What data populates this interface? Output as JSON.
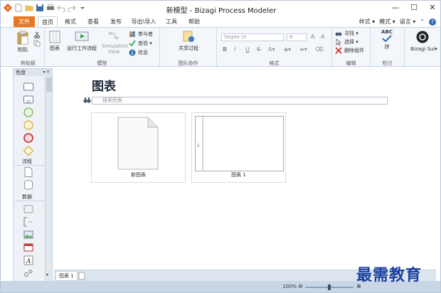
{
  "window": {
    "title": "新模型 - Bizagi Process Modeler"
  },
  "tabs": {
    "file": "文件",
    "home": "首页",
    "format": "格式",
    "view": "查看",
    "publish": "发布",
    "export_import": "导出\\导入",
    "tools": "工具",
    "help": "帮助"
  },
  "right_menus": {
    "styles": "样式 ▾",
    "modes": "模式 ▾",
    "language": "语言 ▾"
  },
  "ribbon": {
    "clipboard": {
      "paste": "粘贴",
      "label": "剪贴板"
    },
    "model": {
      "diagram": "图表",
      "run_workflow": "运行工作流程",
      "simulation": "Simulation View",
      "participants": "参与者",
      "check": "查验 ▾",
      "info": "信息",
      "label": "模型"
    },
    "collab": {
      "share": "共享过程",
      "label": "团队协作"
    },
    "font": {
      "family": "Segoe UI",
      "size": "8",
      "bold": "B",
      "italic": "I",
      "underline": "U",
      "strike": "S",
      "label": "格式"
    },
    "edit": {
      "find": "寻找 ▾",
      "select": "选择 ▾",
      "delete": "删除组件",
      "label": "编辑"
    },
    "spell": {
      "abc": "ABC",
      "spell": "拼",
      "label": "检讨"
    },
    "bizagi": {
      "label": "Bizagi Sui▾"
    }
  },
  "palette": {
    "title": "色盘",
    "pin": "▾ ⊓",
    "flow": "流程",
    "data": "数据"
  },
  "main": {
    "heading": "图表",
    "search_placeholder": "搜索图表",
    "cards": [
      {
        "label": "新图表"
      },
      {
        "label": "图表 1"
      }
    ]
  },
  "doctabs": {
    "tab1": "图表 1"
  },
  "status": {
    "zoom": "100%"
  },
  "watermark": "最需教育"
}
